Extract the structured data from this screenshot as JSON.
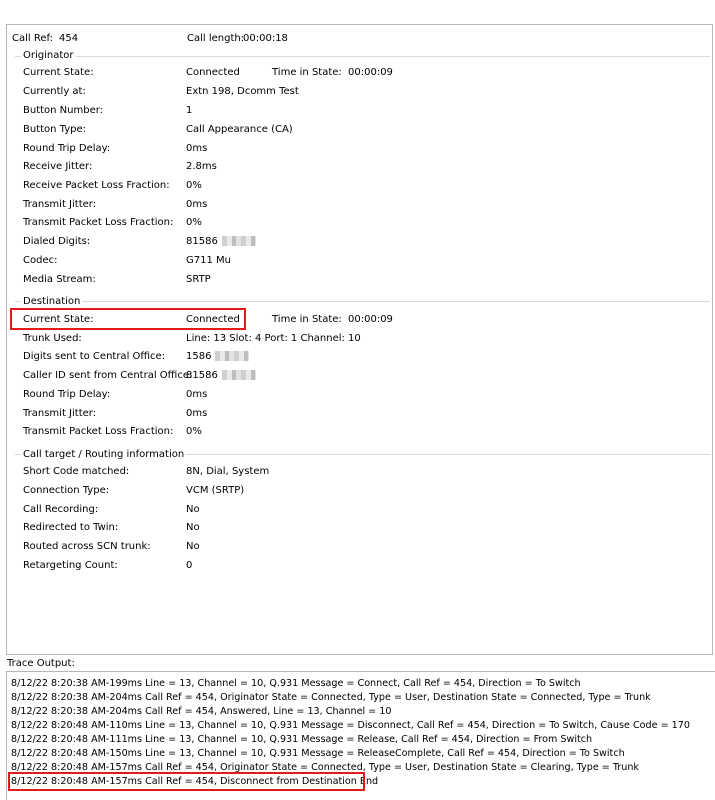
{
  "header": {
    "call_ref_label": "Call Ref:",
    "call_ref_value": "454",
    "call_length_label": "Call length:",
    "call_length_value": "00:00:18"
  },
  "originator": {
    "title": "Originator",
    "current_state_label": "Current State:",
    "current_state_value": "Connected",
    "time_in_state_label": "Time in State:",
    "time_in_state_value": "00:00:09",
    "currently_at_label": "Currently at:",
    "currently_at_value": "Extn 198, Dcomm Test",
    "button_number_label": "Button Number:",
    "button_number_value": "1",
    "button_type_label": "Button Type:",
    "button_type_value": "Call Appearance (CA)",
    "round_trip_label": "Round Trip Delay:",
    "round_trip_value": "0ms",
    "receive_jitter_label": "Receive Jitter:",
    "receive_jitter_value": "2.8ms",
    "receive_loss_label": "Receive Packet Loss Fraction:",
    "receive_loss_value": "0%",
    "transmit_jitter_label": "Transmit Jitter:",
    "transmit_jitter_value": "0ms",
    "transmit_loss_label": "Transmit Packet Loss Fraction:",
    "transmit_loss_value": "0%",
    "dialed_digits_label": "Dialed Digits:",
    "dialed_digits_value": "81586",
    "codec_label": "Codec:",
    "codec_value": "G711 Mu",
    "media_stream_label": "Media Stream:",
    "media_stream_value": "SRTP"
  },
  "destination": {
    "title": "Destination",
    "current_state_label": "Current State:",
    "current_state_value": "Connected",
    "time_in_state_label": "Time in State:",
    "time_in_state_value": "00:00:09",
    "trunk_used_label": "Trunk Used:",
    "trunk_used_value": "Line: 13  Slot: 4  Port: 1  Channel: 10",
    "digits_sent_label": "Digits sent to Central Office:",
    "digits_sent_value": "1586",
    "caller_id_label": "Caller ID sent from Central Office:",
    "caller_id_value": "81586",
    "round_trip_label": "Round Trip Delay:",
    "round_trip_value": "0ms",
    "transmit_jitter_label": "Transmit Jitter:",
    "transmit_jitter_value": "0ms",
    "transmit_loss_label": "Transmit Packet Loss Fraction:",
    "transmit_loss_value": "0%"
  },
  "routing": {
    "title": "Call target / Routing information",
    "short_code_label": "Short Code matched:",
    "short_code_value": "8N, Dial, System",
    "connection_type_label": "Connection Type:",
    "connection_type_value": "VCM (SRTP)",
    "call_recording_label": "Call Recording:",
    "call_recording_value": "No",
    "redirected_label": "Redirected to Twin:",
    "redirected_value": "No",
    "routed_label": "Routed across SCN trunk:",
    "routed_value": "No",
    "retargeting_label": "Retargeting Count:",
    "retargeting_value": "0"
  },
  "trace": {
    "label": "Trace Output:",
    "lines": [
      "8/12/22 8:20:38 AM-199ms  Line = 13, Channel = 10, Q.931 Message = Connect, Call Ref = 454, Direction = To Switch",
      "8/12/22 8:20:38 AM-204ms  Call Ref = 454, Originator State = Connected, Type = User, Destination State = Connected, Type = Trunk",
      "8/12/22 8:20:38 AM-204ms  Call Ref = 454, Answered, Line = 13, Channel = 10",
      "8/12/22 8:20:48 AM-110ms  Line = 13, Channel = 10, Q.931 Message = Disconnect, Call Ref = 454, Direction = To Switch, Cause Code = 170",
      "8/12/22 8:20:48 AM-111ms  Line = 13, Channel = 10, Q.931 Message = Release, Call Ref = 454, Direction = From Switch",
      "8/12/22 8:20:48 AM-150ms  Line = 13, Channel = 10, Q.931 Message = ReleaseComplete, Call Ref = 454, Direction = To Switch",
      "8/12/22 8:20:48 AM-157ms  Call Ref = 454, Originator State = Connected, Type = User, Destination State = Clearing, Type = Trunk",
      "8/12/22 8:20:48 AM-157ms  Call Ref = 454, Disconnect from Destination End"
    ]
  },
  "colors": {
    "highlight": "#e01b1b",
    "border": "#b7b7b7"
  }
}
